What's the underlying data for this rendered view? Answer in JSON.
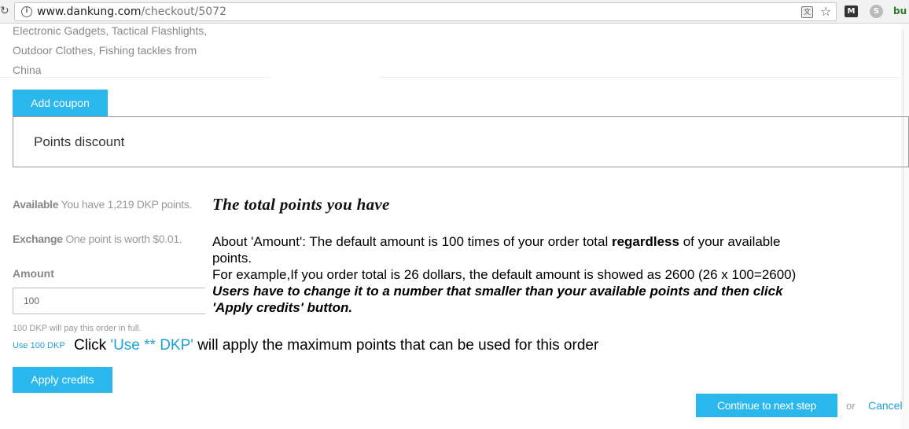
{
  "browser": {
    "url_host": "www.dankung.com",
    "url_path": "/checkout/5072",
    "ext_bu_label": "bu"
  },
  "page": {
    "blurb_lines": [
      "Electronic Gadgets, Tactical Flashlights,",
      "Outdoor Clothes, Fishing tackles from",
      "China"
    ],
    "add_coupon_label": "Add coupon",
    "points_discount_title": "Points discount",
    "available_label": "Available",
    "available_value": "You have 1,219 DKP points.",
    "exchange_label": "Exchange",
    "exchange_value": "One point is worth $0.01.",
    "amount_label": "Amount",
    "amount_value": "100",
    "pay_note": "100 DKP will pay this order in full.",
    "use_link": "Use 100 DKP",
    "apply_credits_label": "Apply credits",
    "continue_label": "Continue to next step",
    "or_text": "or",
    "cancel_label": "Cancel"
  },
  "annotation": {
    "title": "The total points you have",
    "line1_pre": "About 'Amount': The default amount is 100 times of your order total ",
    "line1_bold": "regardless",
    "line1_post": " of your available",
    "line2": "points.",
    "line3": "For example,If you order total is 26 dollars, the default amount is showed as 2600 (26 x 100=2600)",
    "line4": "Users have to change it to a number that smaller than your available points and then click",
    "line5": "'Apply credits' button.",
    "click_pre": "Click ",
    "click_highlight": "'Use ** DKP'",
    "click_post": " will apply the maximum points that can be used for this order"
  }
}
